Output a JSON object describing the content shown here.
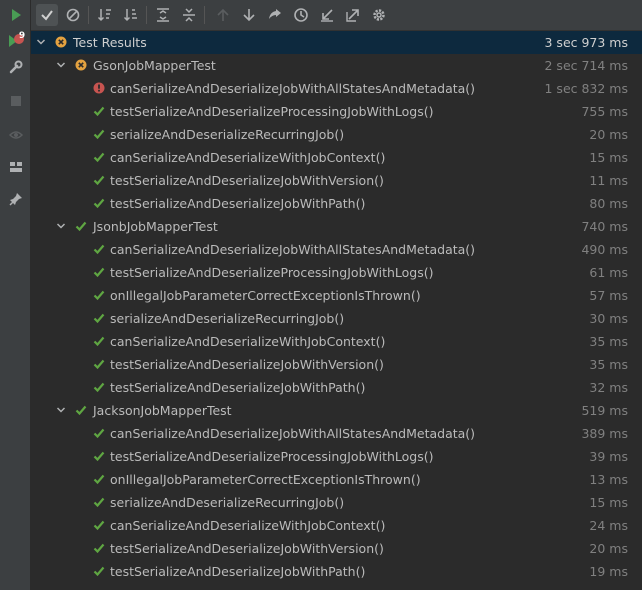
{
  "toolbar": {
    "buttons": [
      {
        "name": "rerun-icon"
      },
      {
        "name": "show-passed-icon"
      },
      {
        "name": "show-ignored-icon"
      },
      {
        "name": "sort-alphabetically-icon"
      },
      {
        "name": "sort-by-duration-icon"
      },
      {
        "name": "expand-all-icon"
      },
      {
        "name": "collapse-all-icon"
      },
      {
        "name": "previous-failed-icon"
      },
      {
        "name": "next-failed-icon"
      },
      {
        "name": "coverage-icon"
      },
      {
        "name": "history-icon"
      },
      {
        "name": "import-tests-icon"
      },
      {
        "name": "export-tests-icon"
      },
      {
        "name": "settings-icon"
      }
    ]
  },
  "sidebar": {
    "rerun_failed_badge": "9"
  },
  "colors": {
    "pass": "#5fa642",
    "fail": "#c75450",
    "warn": "#e4a240",
    "selection": "#0d293e"
  },
  "tree": {
    "root": {
      "label": "Test Results",
      "time": "3 sec 973 ms",
      "status": "failed"
    },
    "suites": [
      {
        "label": "GsonJobMapperTest",
        "time": "2 sec 714 ms",
        "status": "failed",
        "tests": [
          {
            "label": "canSerializeAndDeserializeJobWithAllStatesAndMetadata()",
            "time": "1 sec 832 ms",
            "status": "error"
          },
          {
            "label": "testSerializeAndDeserializeProcessingJobWithLogs()",
            "time": "755 ms",
            "status": "passed"
          },
          {
            "label": "serializeAndDeserializeRecurringJob()",
            "time": "20 ms",
            "status": "passed"
          },
          {
            "label": "canSerializeAndDeserializeWithJobContext()",
            "time": "15 ms",
            "status": "passed"
          },
          {
            "label": "testSerializeAndDeserializeJobWithVersion()",
            "time": "11 ms",
            "status": "passed"
          },
          {
            "label": "testSerializeAndDeserializeJobWithPath()",
            "time": "80 ms",
            "status": "passed"
          }
        ]
      },
      {
        "label": "JsonbJobMapperTest",
        "time": "740 ms",
        "status": "passed",
        "tests": [
          {
            "label": "canSerializeAndDeserializeJobWithAllStatesAndMetadata()",
            "time": "490 ms",
            "status": "passed"
          },
          {
            "label": "testSerializeAndDeserializeProcessingJobWithLogs()",
            "time": "61 ms",
            "status": "passed"
          },
          {
            "label": "onIllegalJobParameterCorrectExceptionIsThrown()",
            "time": "57 ms",
            "status": "passed"
          },
          {
            "label": "serializeAndDeserializeRecurringJob()",
            "time": "30 ms",
            "status": "passed"
          },
          {
            "label": "canSerializeAndDeserializeWithJobContext()",
            "time": "35 ms",
            "status": "passed"
          },
          {
            "label": "testSerializeAndDeserializeJobWithVersion()",
            "time": "35 ms",
            "status": "passed"
          },
          {
            "label": "testSerializeAndDeserializeJobWithPath()",
            "time": "32 ms",
            "status": "passed"
          }
        ]
      },
      {
        "label": "JacksonJobMapperTest",
        "time": "519 ms",
        "status": "passed",
        "tests": [
          {
            "label": "canSerializeAndDeserializeJobWithAllStatesAndMetadata()",
            "time": "389 ms",
            "status": "passed"
          },
          {
            "label": "testSerializeAndDeserializeProcessingJobWithLogs()",
            "time": "39 ms",
            "status": "passed"
          },
          {
            "label": "onIllegalJobParameterCorrectExceptionIsThrown()",
            "time": "13 ms",
            "status": "passed"
          },
          {
            "label": "serializeAndDeserializeRecurringJob()",
            "time": "15 ms",
            "status": "passed"
          },
          {
            "label": "canSerializeAndDeserializeWithJobContext()",
            "time": "24 ms",
            "status": "passed"
          },
          {
            "label": "testSerializeAndDeserializeJobWithVersion()",
            "time": "20 ms",
            "status": "passed"
          },
          {
            "label": "testSerializeAndDeserializeJobWithPath()",
            "time": "19 ms",
            "status": "passed"
          }
        ]
      }
    ]
  }
}
